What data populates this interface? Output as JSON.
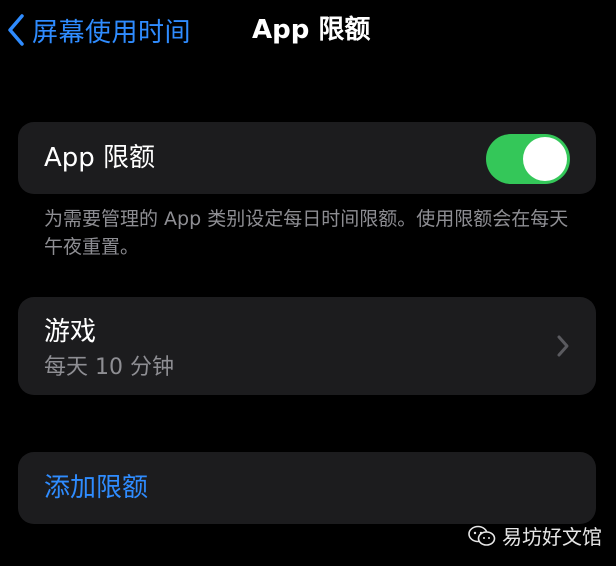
{
  "nav": {
    "back_label": "屏幕使用时间",
    "title": "App 限额"
  },
  "toggle_row": {
    "label": "App 限额",
    "enabled": true
  },
  "footer_note": "为需要管理的 App 类别设定每日时间限额。使用限额会在每天午夜重置。",
  "limit_item": {
    "title": "游戏",
    "subtitle": "每天 10 分钟"
  },
  "add_limit_label": "添加限额",
  "watermark": "易坊好文馆",
  "colors": {
    "background": "#000000",
    "card": "#1c1c1e",
    "accent": "#2f8cff",
    "switch_on": "#34c759",
    "secondary_text": "#8e8e93"
  },
  "icons": {
    "back": "chevron-left-icon",
    "disclosure": "chevron-right-icon",
    "watermark": "wechat-icon"
  }
}
